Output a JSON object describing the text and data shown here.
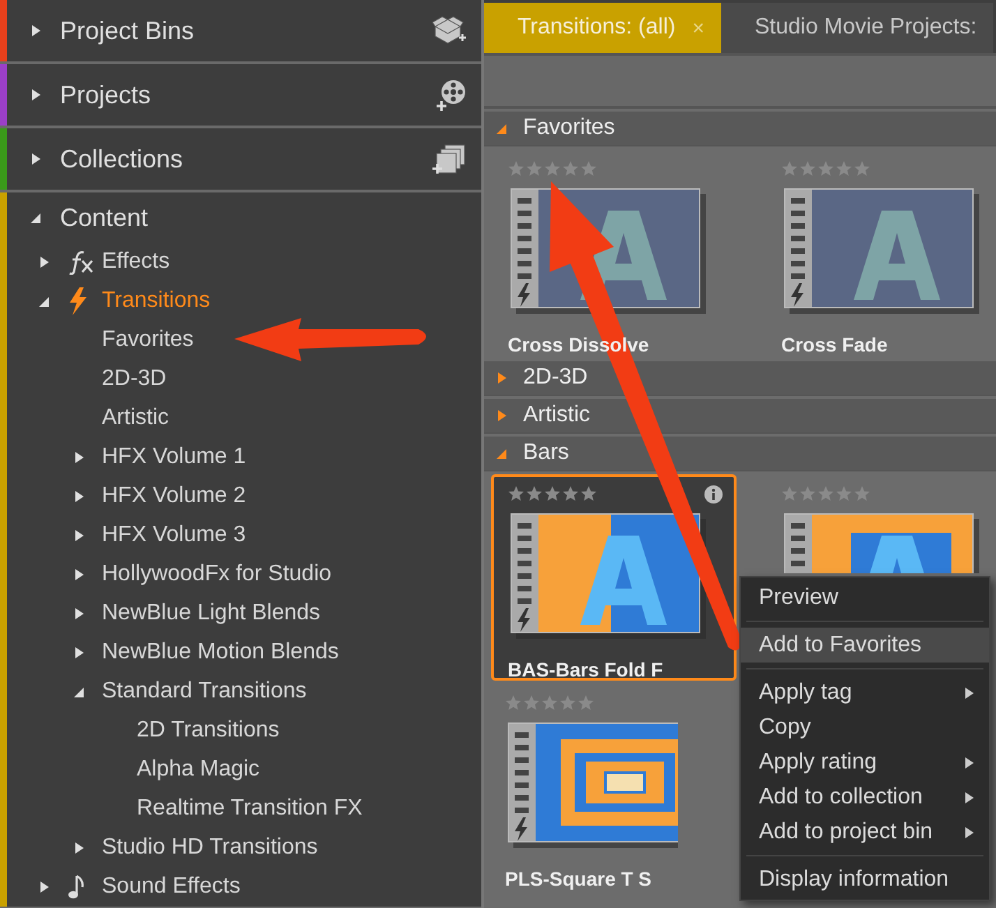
{
  "sidebar": {
    "sections": [
      {
        "label": "Project Bins",
        "expanded": false,
        "color": "#e8401c"
      },
      {
        "label": "Projects",
        "expanded": false,
        "color": "#9b3fc8"
      },
      {
        "label": "Collections",
        "expanded": false,
        "color": "#3a9a1a"
      },
      {
        "label": "Content",
        "expanded": true,
        "color": "#c9a100",
        "tree": [
          {
            "label": "Effects",
            "expanded": false,
            "selected": false
          },
          {
            "label": "Transitions",
            "expanded": true,
            "selected": true,
            "children": [
              {
                "label": "Favorites",
                "selected": false
              },
              {
                "label": "2D-3D",
                "selected": false
              },
              {
                "label": "Artistic",
                "selected": false
              },
              {
                "label": "HFX Volume 1",
                "expanded": false,
                "selected": false
              },
              {
                "label": "HFX Volume 2",
                "expanded": false,
                "selected": false
              },
              {
                "label": "HFX Volume 3",
                "expanded": false,
                "selected": false
              },
              {
                "label": "HollywoodFx for Studio",
                "expanded": false,
                "selected": false
              },
              {
                "label": "NewBlue Light Blends",
                "expanded": false,
                "selected": false
              },
              {
                "label": "NewBlue Motion Blends",
                "expanded": false,
                "selected": false
              },
              {
                "label": "Standard Transitions",
                "expanded": true,
                "selected": false,
                "children": [
                  {
                    "label": "2D Transitions",
                    "selected": false
                  },
                  {
                    "label": "Alpha Magic",
                    "selected": false
                  },
                  {
                    "label": "Realtime Transition FX",
                    "selected": false
                  }
                ]
              },
              {
                "label": "Studio HD Transitions",
                "expanded": false,
                "selected": false
              }
            ]
          },
          {
            "label": "Sound Effects",
            "expanded": false,
            "selected": false
          }
        ]
      }
    ]
  },
  "tabs": [
    {
      "label": "Transitions: (all)",
      "close": "×",
      "selected": true
    },
    {
      "label": "Studio Movie Projects:",
      "selected": false
    }
  ],
  "groups": [
    {
      "label": "Favorites",
      "expanded": true,
      "items": [
        {
          "title": "Cross Dissolve",
          "stars": 0,
          "selected": false,
          "kind": "dissolve"
        },
        {
          "title": "Cross Fade",
          "stars": 0,
          "selected": false,
          "kind": "fade"
        }
      ]
    },
    {
      "label": "2D-3D",
      "expanded": false
    },
    {
      "label": "Artistic",
      "expanded": false
    },
    {
      "label": "Bars",
      "expanded": true,
      "items": [
        {
          "title": "BAS-Bars Fold F",
          "stars": 0,
          "selected": true,
          "kind": "bars"
        },
        {
          "stars": 0,
          "selected": false,
          "kind": "square"
        },
        {
          "title": "PLS-Square T S",
          "stars": 0,
          "selected": false,
          "kind": "tunnel"
        }
      ]
    }
  ],
  "context_menu": {
    "items": [
      {
        "kind": "item",
        "label": "Preview",
        "submenu": false,
        "selected": false
      },
      {
        "kind": "separator"
      },
      {
        "kind": "item",
        "label": "Add to Favorites",
        "submenu": false,
        "selected": true
      },
      {
        "kind": "separator"
      },
      {
        "kind": "item",
        "label": "Apply tag",
        "submenu": true,
        "selected": false
      },
      {
        "kind": "item",
        "label": "Copy",
        "submenu": false,
        "selected": false
      },
      {
        "kind": "item",
        "label": "Apply rating",
        "submenu": true,
        "selected": false
      },
      {
        "kind": "item",
        "label": "Add to collection",
        "submenu": true,
        "selected": false
      },
      {
        "kind": "item",
        "label": "Add to project bin",
        "submenu": true,
        "selected": false
      },
      {
        "kind": "separator"
      },
      {
        "kind": "item",
        "label": "Display information",
        "submenu": false,
        "selected": false
      }
    ]
  }
}
